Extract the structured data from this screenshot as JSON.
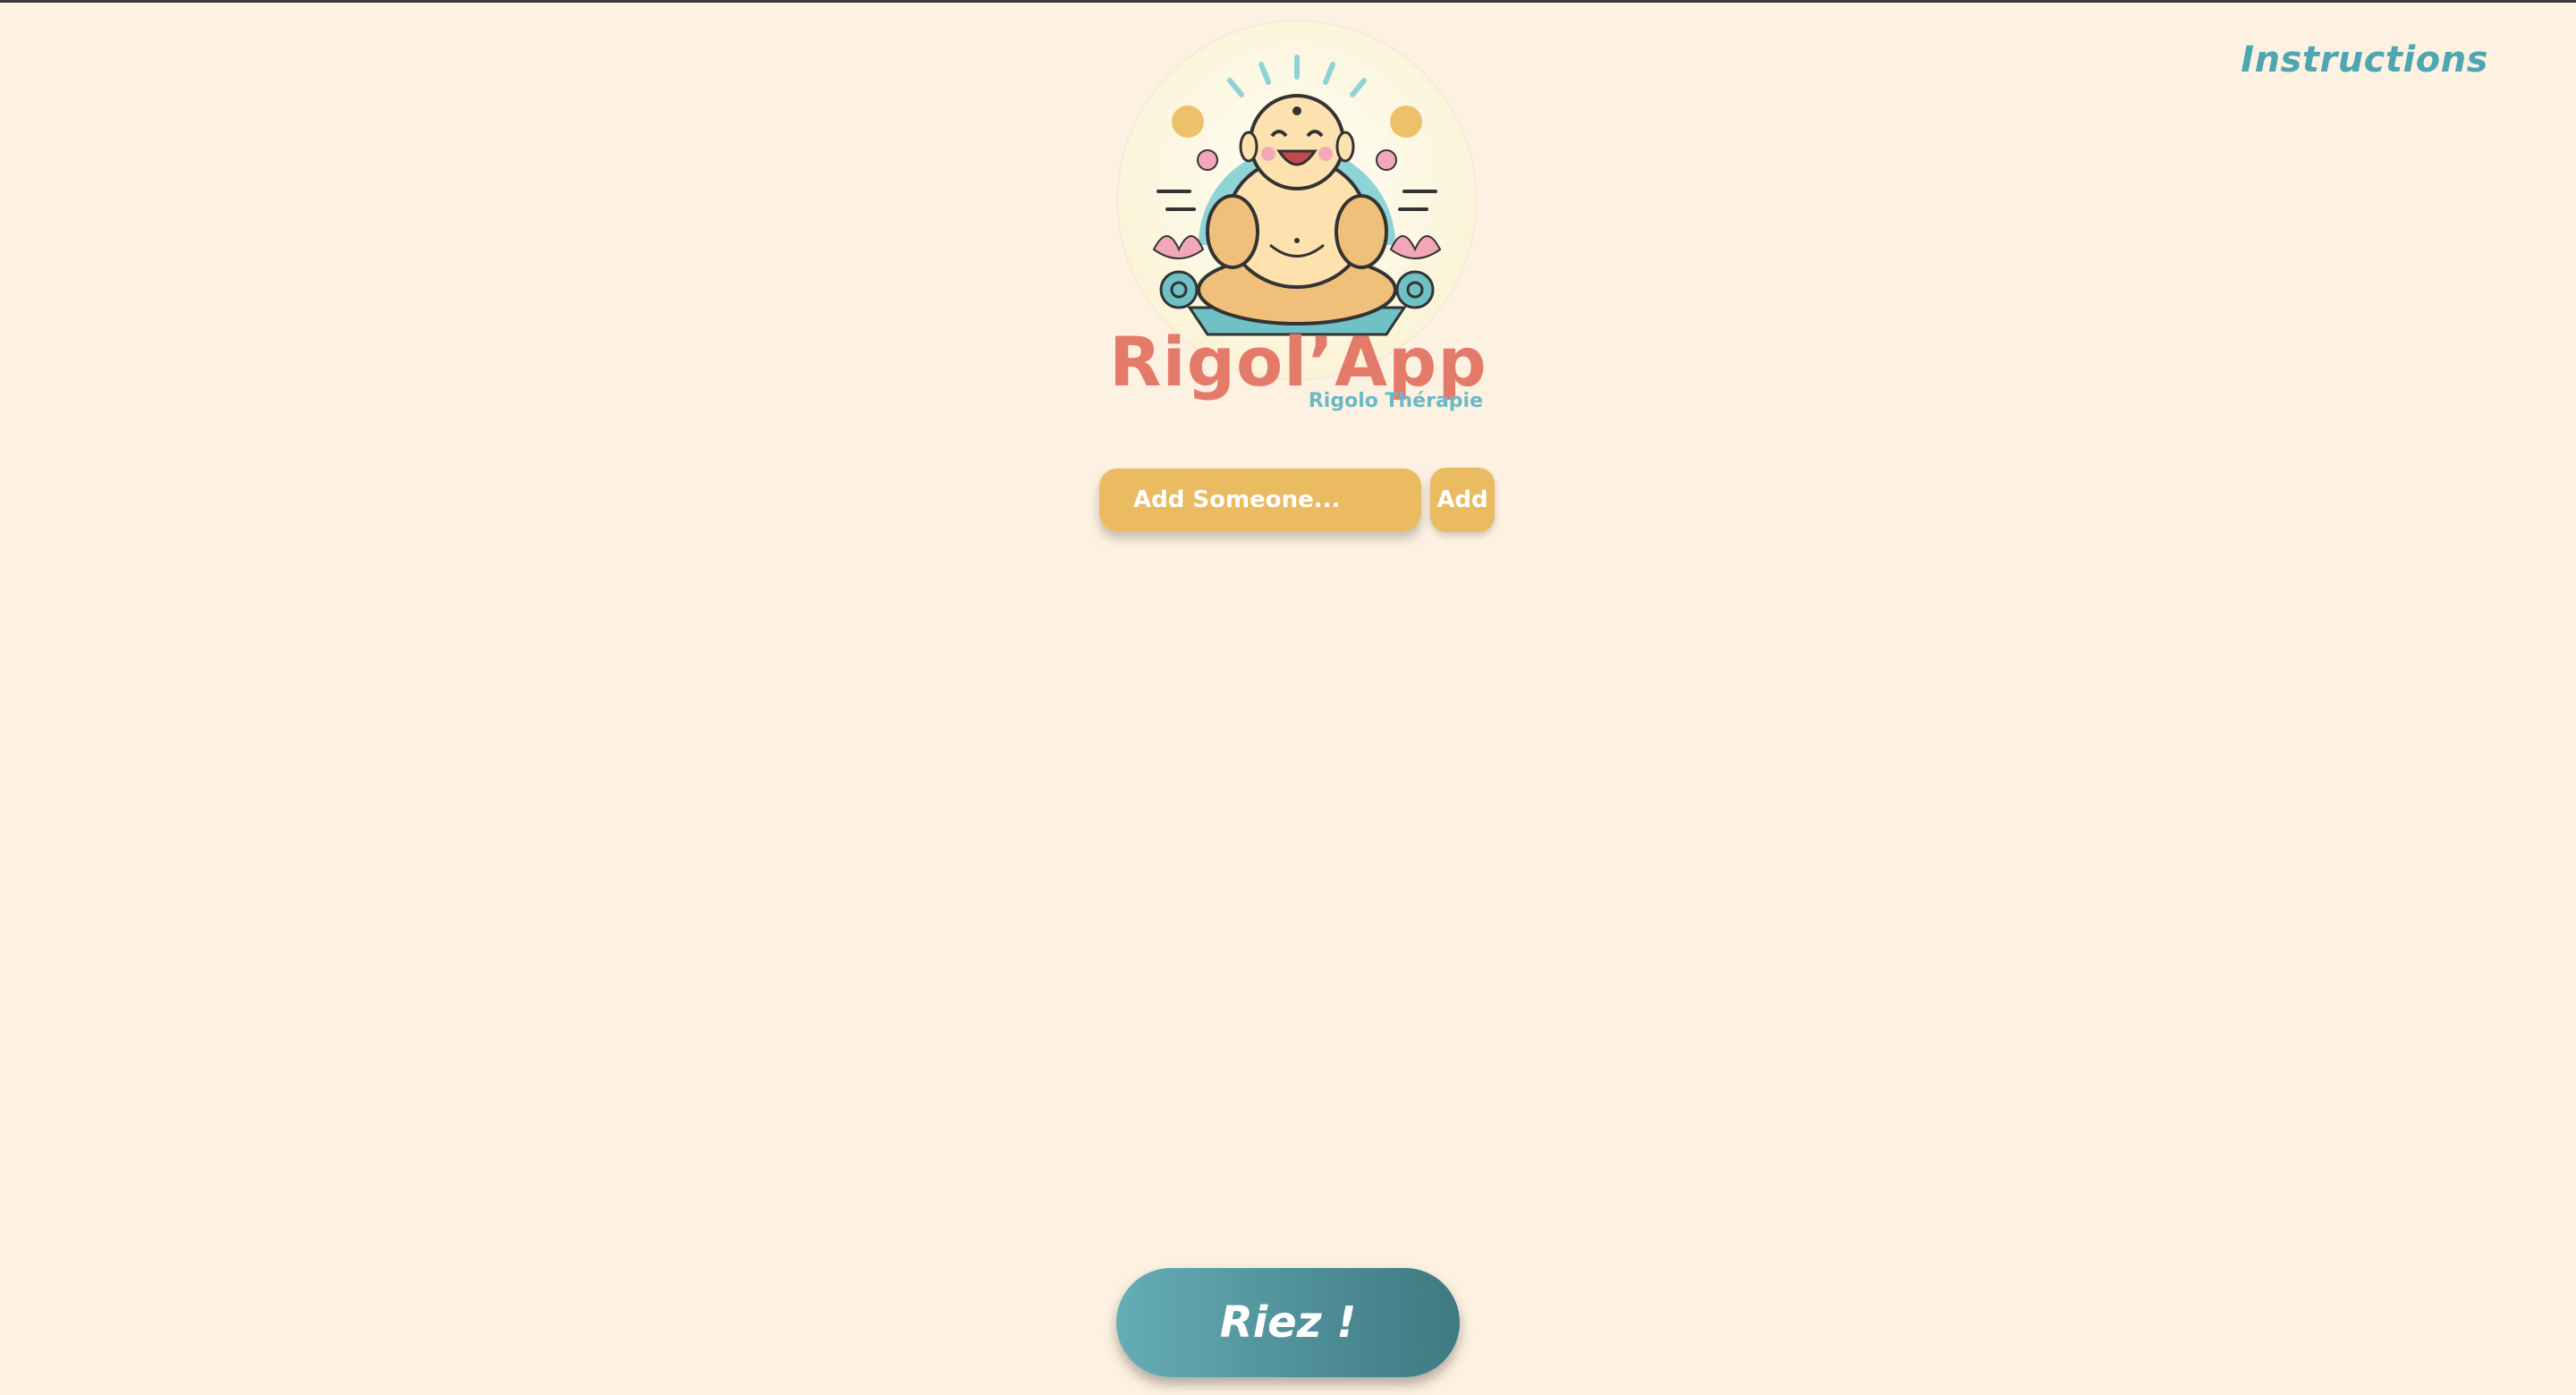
{
  "header": {
    "instructions_label": "Instructions"
  },
  "logo": {
    "title": "Rigol’App",
    "subtitle": "Rigolo Thérapie",
    "icon": "laughing-buddha-icon"
  },
  "add_person": {
    "placeholder": "Add Someone...",
    "value": "",
    "button_label": "Add"
  },
  "main_action": {
    "label": "Riez !"
  },
  "colors": {
    "background": "#fdf1e1",
    "accent_yellow": "#eabb60",
    "accent_teal": "#4fa6b3",
    "title_coral": "#e47a6a"
  }
}
